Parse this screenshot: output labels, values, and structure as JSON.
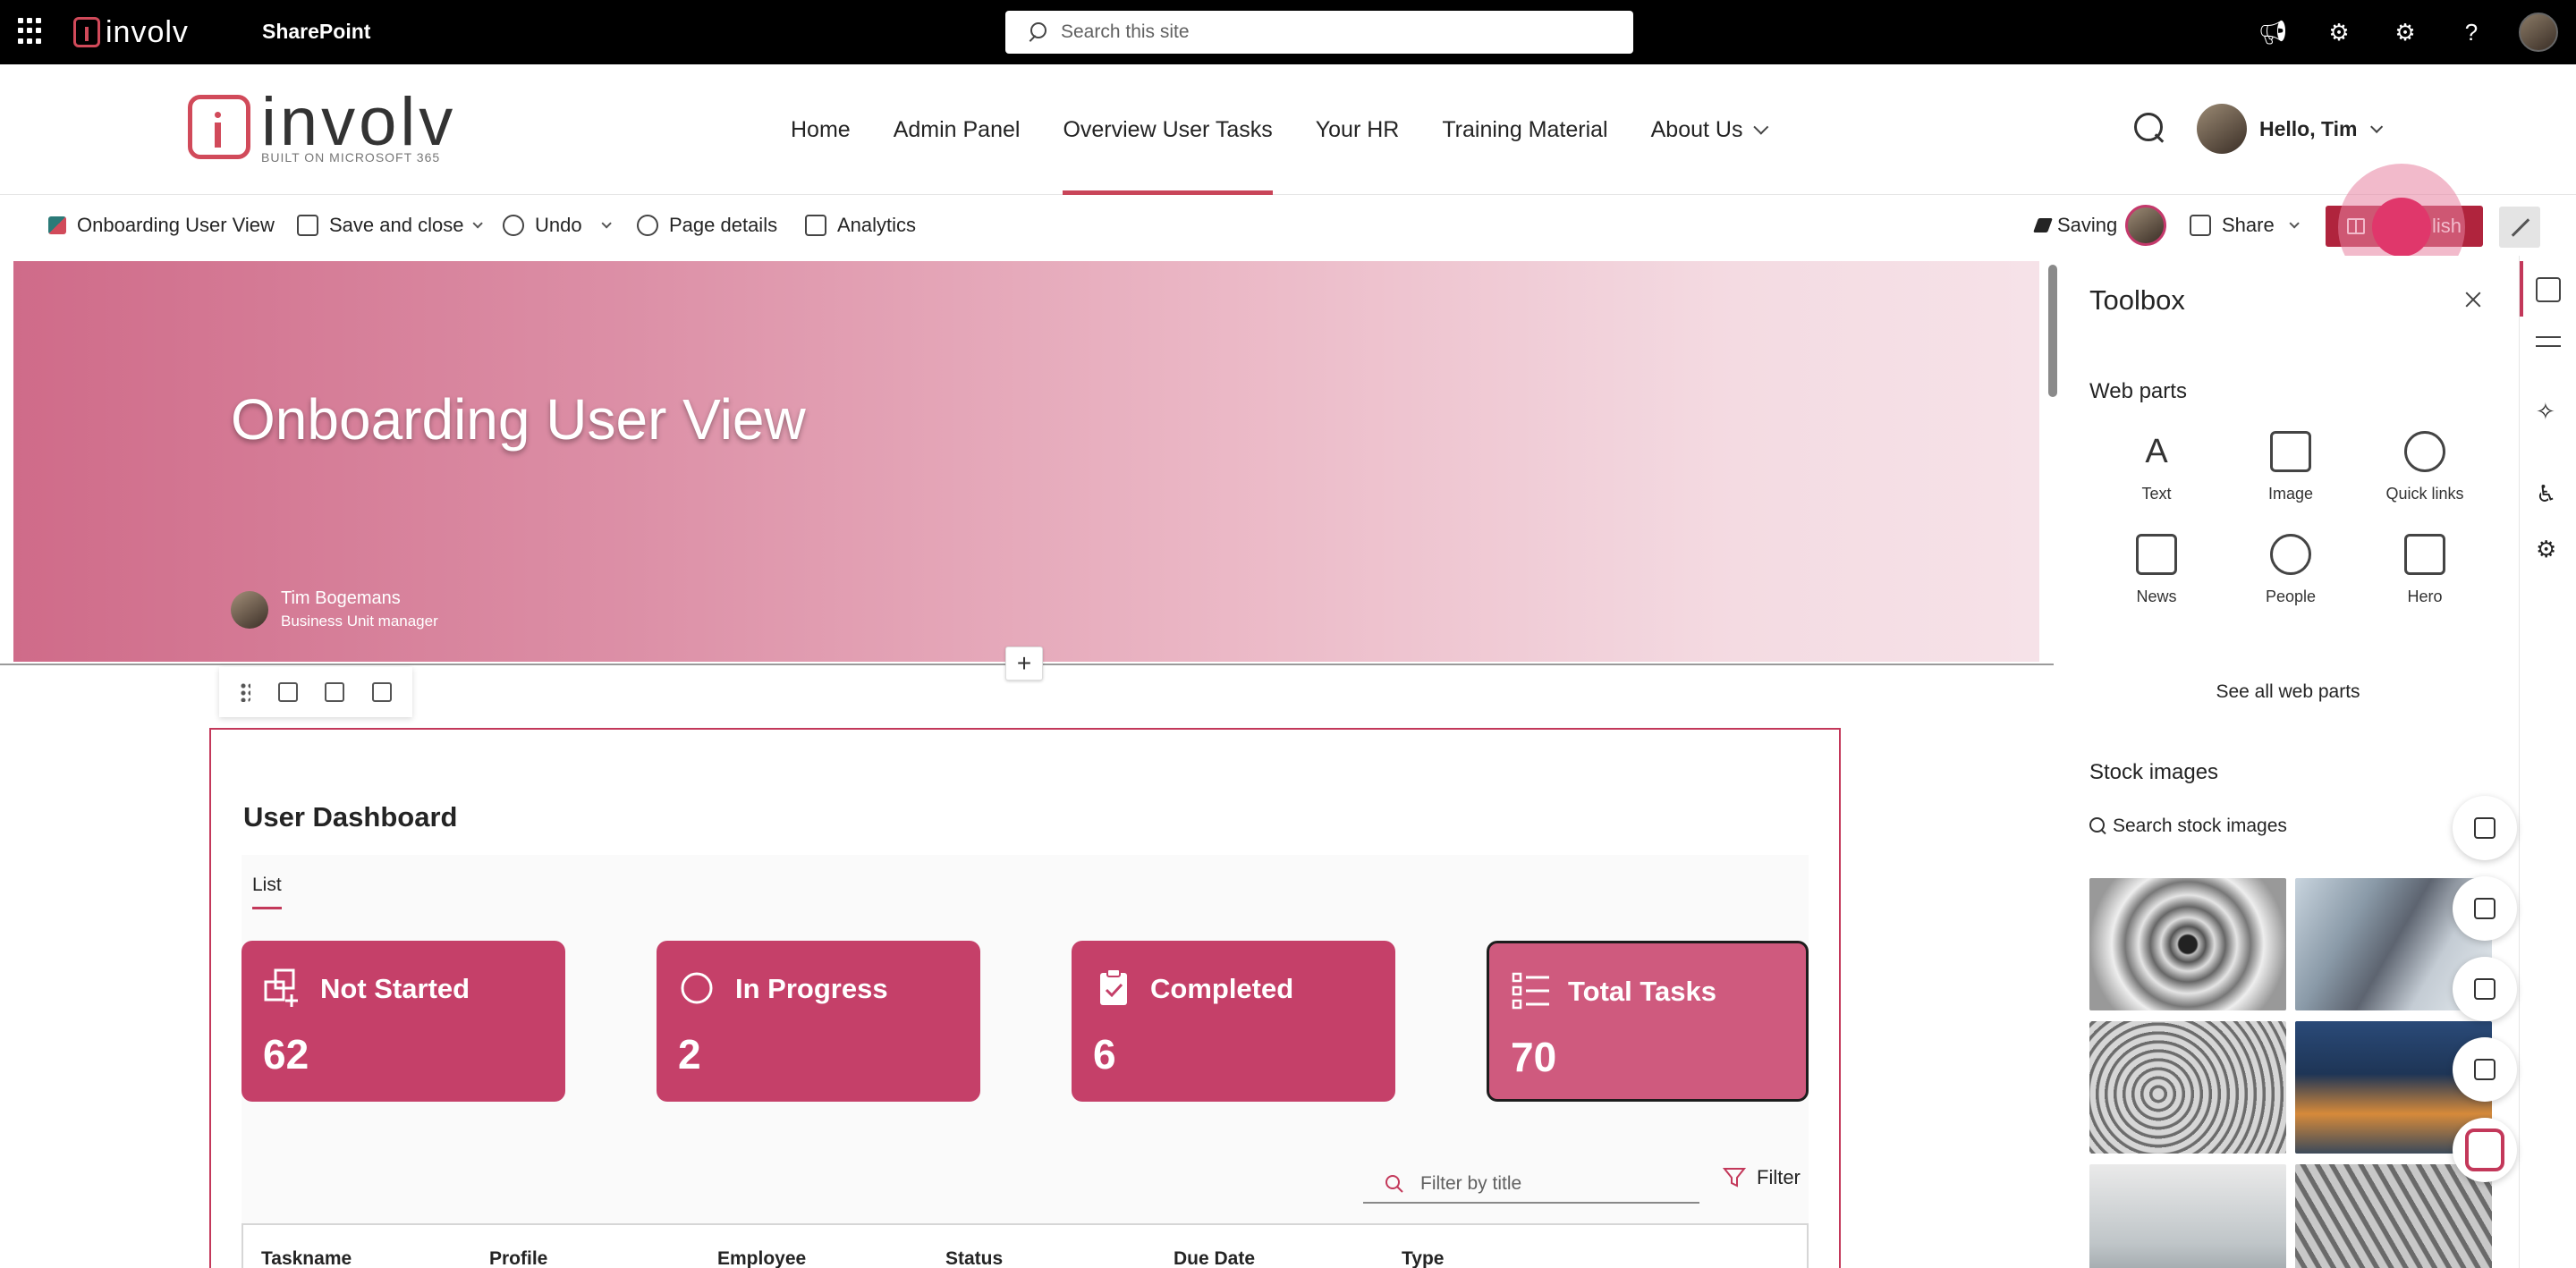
{
  "suitebar": {
    "brand": "involv",
    "app_name": "SharePoint",
    "search_placeholder": "Search this site",
    "icons": [
      "megaphone-icon",
      "teams-icon",
      "gear-icon",
      "help-icon",
      "avatar"
    ]
  },
  "site_header": {
    "logo_word": "involv",
    "logo_tagline": "BUILT ON MICROSOFT 365",
    "nav": [
      {
        "label": "Home"
      },
      {
        "label": "Admin Panel"
      },
      {
        "label": "Overview User Tasks",
        "active": true
      },
      {
        "label": "Your HR"
      },
      {
        "label": "Training Material"
      },
      {
        "label": "About Us",
        "has_menu": true
      }
    ],
    "greeting": "Hello, Tim"
  },
  "command_bar": {
    "page_name": "Onboarding User View",
    "save_close": "Save and close",
    "undo": "Undo",
    "page_details": "Page details",
    "analytics": "Analytics",
    "saving": "Saving",
    "share": "Share",
    "publish_suffix": "lish"
  },
  "hero": {
    "title": "Onboarding User View",
    "author_name": "Tim Bogemans",
    "author_role": "Business Unit manager"
  },
  "dashboard": {
    "title": "User Dashboard",
    "tab": "List",
    "tiles": [
      {
        "label": "Not Started",
        "value": "62",
        "icon": "tasks-add-icon"
      },
      {
        "label": "In Progress",
        "value": "2",
        "icon": "circle-icon"
      },
      {
        "label": "Completed",
        "value": "6",
        "icon": "clipboard-check-icon"
      },
      {
        "label": "Total Tasks",
        "value": "70",
        "icon": "list-icon"
      }
    ],
    "filter_placeholder": "Filter by title",
    "filter_button": "Filter",
    "columns": [
      "Taskname",
      "Profile",
      "Employee",
      "Status",
      "Due Date",
      "Type"
    ]
  },
  "toolbox": {
    "title": "Toolbox",
    "web_parts_heading": "Web parts",
    "web_parts": [
      {
        "label": "Text",
        "icon": "text-icon"
      },
      {
        "label": "Image",
        "icon": "image-icon"
      },
      {
        "label": "Quick links",
        "icon": "globe-icon"
      },
      {
        "label": "News",
        "icon": "news-icon"
      },
      {
        "label": "People",
        "icon": "person-icon"
      },
      {
        "label": "Hero",
        "icon": "hero-icon"
      }
    ],
    "see_all": "See all web parts",
    "stock_heading": "Stock images",
    "stock_search": "Search stock images"
  },
  "colors": {
    "accent": "#c3385a",
    "tile": "#c54069",
    "publish": "#b0243d",
    "suitebar": "#000000"
  }
}
